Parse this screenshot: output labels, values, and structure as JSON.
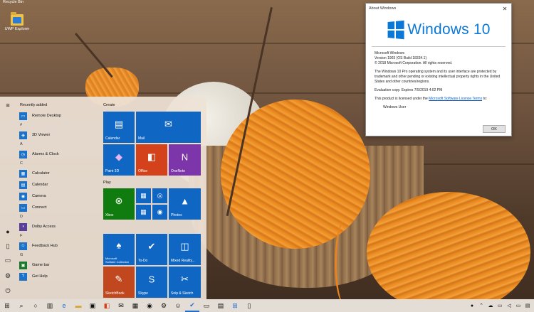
{
  "desktop": {
    "recycle_bin_label": "Recycle Bin",
    "uwp_explorer_label": "UWP Explorer"
  },
  "about_dialog": {
    "title": "About Windows",
    "logo_text": "Windows 10",
    "product_line": "Microsoft Windows",
    "version_line": "Version 1903 (OS Build 18334.1)",
    "copyright_line": "© 2018 Microsoft Corporation. All rights reserved.",
    "description": "The Windows 10 Pro operating system and its user interface are protected by trademark and other pending or existing intellectual property rights in the United States and other countries/regions.",
    "evaluation": "Evaluation copy. Expires 7/5/2019 4:02 PM",
    "license_prefix": "This product is licensed under the",
    "license_link": "Microsoft Software License Terms",
    "license_suffix": "to:",
    "licensed_user": "Windows User",
    "ok_label": "OK",
    "accent_color": "#0a78d7"
  },
  "start_menu": {
    "recently_added_label": "Recently added",
    "letters": {
      "hash": "#",
      "a": "A",
      "c": "C",
      "d": "D",
      "f": "F",
      "g": "G"
    },
    "apps": {
      "remote_desktop": "Remote Desktop",
      "viewer_3d": "3D Viewer",
      "alarms": "Alarms & Clock",
      "calculator": "Calculator",
      "calendar": "Calendar",
      "camera": "Camera",
      "connect": "Connect",
      "dolby": "Dolby Access",
      "feedback": "Feedback Hub",
      "game_bar": "Game bar",
      "get_help": "Get Help"
    },
    "groups": {
      "create": "Create",
      "play": "Play"
    },
    "tiles": {
      "calendar": "Calendar",
      "mail": "Mail",
      "paint3d": "Paint 3D",
      "office": "Office",
      "onenote": "OneNote",
      "xbox": "Xbox",
      "photos": "Photos",
      "solitaire_line1": "Microsoft",
      "solitaire_line2": "Solitaire Collection",
      "todo": "To-Do",
      "mixed_reality": "Mixed Reality...",
      "sketchbook": "SketchBook",
      "skype": "Skype",
      "snip_sketch": "Snip & Sketch"
    }
  },
  "taskbar": {
    "items": [
      "start",
      "search",
      "task-view",
      "edge",
      "file-explorer",
      "store",
      "office",
      "mail",
      "calculator",
      "camera",
      "settings",
      "feedback",
      "todo",
      "photos",
      "uwp-explorer",
      "notepad"
    ],
    "tray_time_hidden": true
  }
}
